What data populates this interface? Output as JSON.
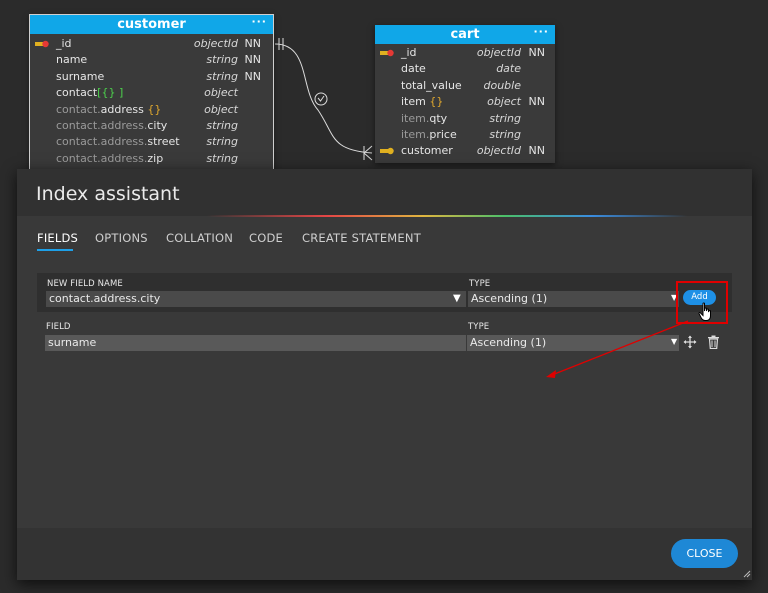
{
  "diagram": {
    "customer": {
      "title": "customer",
      "menu_glyph": "···",
      "rows": [
        {
          "name": "_id",
          "type": "objectId",
          "nn": "NN"
        },
        {
          "name": "name",
          "type": "string",
          "nn": "NN"
        },
        {
          "name": "surname",
          "type": "string",
          "nn": "NN"
        },
        {
          "name": "contact",
          "bracket": "[{} ]",
          "type": "object",
          "nn": ""
        },
        {
          "name_prefix": "contact.",
          "name": "address",
          "suffix": "{}",
          "type": "object",
          "nn": ""
        },
        {
          "name_prefix": "contact.address.",
          "name": "city",
          "type": "string",
          "nn": ""
        },
        {
          "name_prefix": "contact.address.",
          "name": "street",
          "type": "string",
          "nn": ""
        },
        {
          "name_prefix": "contact.address.",
          "name": "zip",
          "type": "string",
          "nn": ""
        }
      ]
    },
    "cart": {
      "title": "cart",
      "menu_glyph": "···",
      "rows": [
        {
          "name": "_id",
          "type": "objectId",
          "nn": "NN"
        },
        {
          "name": "date",
          "type": "date",
          "nn": ""
        },
        {
          "name": "total_value",
          "type": "double",
          "nn": ""
        },
        {
          "name": "item",
          "suffix": "{}",
          "type": "object",
          "nn": "NN"
        },
        {
          "name_prefix": "item.",
          "name": "qty",
          "type": "string",
          "nn": ""
        },
        {
          "name_prefix": "item.",
          "name": "price",
          "type": "string",
          "nn": ""
        },
        {
          "name": "customer",
          "type": "objectId",
          "nn": "NN"
        }
      ]
    },
    "colors": {
      "header": "#10a7e8",
      "pk_key": "#e53935",
      "fk_key": "#e0b020"
    }
  },
  "dialog": {
    "title": "Index assistant",
    "tabs": [
      "FIELDS",
      "OPTIONS",
      "COLLATION",
      "CODE",
      "CREATE STATEMENT"
    ],
    "active_tab": "FIELDS",
    "new_field": {
      "name_label": "NEW FIELD NAME",
      "name_value": "contact.address.city",
      "type_label": "TYPE",
      "type_value": "Ascending (1)",
      "add_label": "Add"
    },
    "field_row": {
      "name_label": "FIELD",
      "name_value": "surname",
      "type_label": "TYPE",
      "type_value": "Ascending (1)"
    },
    "close_label": "CLOSE",
    "accent": "#1e90e6",
    "annotation_color": "#e00000"
  }
}
